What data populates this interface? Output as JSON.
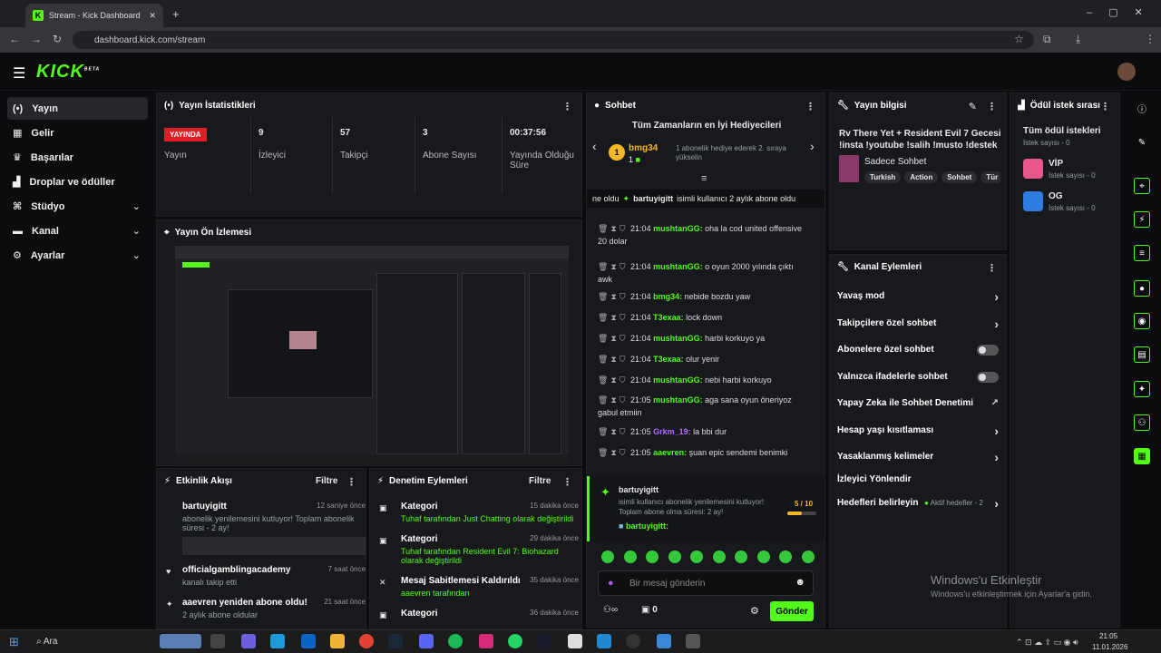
{
  "browser": {
    "tab_title": "Stream - Kick Dashboard",
    "url": "dashboard.kick.com/stream"
  },
  "brand": {
    "logo": "KICK",
    "beta": "BETA",
    "accent": "#53fc18"
  },
  "sidebar": {
    "items": [
      {
        "label": "Yayın",
        "icon": "broadcast-icon"
      },
      {
        "label": "Gelir",
        "icon": "dollar-icon"
      },
      {
        "label": "Başarılar",
        "icon": "trophy-icon"
      },
      {
        "label": "Droplar ve ödüller",
        "icon": "gift-icon"
      },
      {
        "label": "Stüdyo",
        "icon": "studio-icon"
      },
      {
        "label": "Kanal",
        "icon": "channel-icon"
      },
      {
        "label": "Ayarlar",
        "icon": "gear-icon"
      }
    ]
  },
  "stats": {
    "title": "Yayın İstatistikleri",
    "live_badge": "YAYINDA",
    "live_label": "Yayın",
    "items": [
      {
        "value": "9",
        "label": "İzleyici"
      },
      {
        "value": "57",
        "label": "Takipçi"
      },
      {
        "value": "3",
        "label": "Abone Sayısı"
      },
      {
        "value": "00:37:56",
        "label": "Yayında Olduğu Süre"
      }
    ]
  },
  "preview": {
    "title": "Yayın Ön İzlemesi"
  },
  "chat": {
    "title": "Sohbet",
    "top_gifters_title": "Tüm Zamanların en İyi Hediyecileri",
    "top_gifter": {
      "name": "bmg34",
      "count": "1",
      "rank": "1",
      "note": "1 abonelik hediye ederek 2. sıraya yükselin"
    },
    "banner_prefix": "ne oldu",
    "banner_user": "bartuyigitt",
    "banner_text": "isimli kullanıcı 2 aylık abone oldu",
    "messages": [
      {
        "time": "21:04",
        "user": "mushtanGG:",
        "text": "oha la cod united offensive 20 dolar",
        "color": "#53fc18"
      },
      {
        "time": "21:04",
        "user": "mushtanGG:",
        "text": "o oyun 2000 yılında çıktı awk",
        "color": "#53fc18"
      },
      {
        "time": "21:04",
        "user": "bmg34:",
        "text": "nebide bozdu yaw",
        "color": "#53fc18"
      },
      {
        "time": "21:04",
        "user": "T3exaa:",
        "text": "lock down",
        "color": "#53fc18"
      },
      {
        "time": "21:04",
        "user": "mushtanGG:",
        "text": "harbi korkuyo ya",
        "color": "#53fc18"
      },
      {
        "time": "21:04",
        "user": "T3exaa:",
        "text": "olur yenir",
        "color": "#53fc18"
      },
      {
        "time": "21:04",
        "user": "mushtanGG:",
        "text": "nebi harbi korkuyo",
        "color": "#53fc18"
      },
      {
        "time": "21:05",
        "user": "mushtanGG:",
        "text": "aga sana oyun öneriyoz gabul etmiin",
        "color": "#53fc18"
      },
      {
        "time": "21:05",
        "user": "Grkm_19:",
        "text": "la bbi dur",
        "color": "#b06cff"
      },
      {
        "time": "21:05",
        "user": "aaevren:",
        "text": "şuan epic sendemi benimki",
        "color": "#53fc18"
      }
    ],
    "sub_event": {
      "user": "bartuyigitt",
      "line1": "isimli kullanıcı abonelik yenilemesini kutluyor!",
      "line2": "Toplam abone olma süresi: 2 ay!",
      "progress_text": "5 / 10",
      "progress": 0.5,
      "reply_user": "bartuyigitt:"
    },
    "input_placeholder": "Bir mesaj gönderin",
    "send_label": "Gönder",
    "points": "0"
  },
  "stream_info": {
    "title": "Yayın bilgisi",
    "stream_title": "Rv There Yet + Resident Evil 7 Gecesi !insta !youtube !salih !musto !destek",
    "category": "Sadece Sohbet",
    "tags": [
      "Turkish",
      "Action",
      "Sohbet",
      "Tür"
    ]
  },
  "channel_actions": {
    "title": "Kanal Eylemleri",
    "items": [
      {
        "label": "Yavaş mod",
        "type": "chevron"
      },
      {
        "label": "Takipçilere özel sohbet",
        "type": "chevron"
      },
      {
        "label": "Abonelere özel sohbet",
        "type": "toggle"
      },
      {
        "label": "Yalnızca ifadelerle sohbet",
        "type": "toggle"
      },
      {
        "label": "Yapay Zeka ile Sohbet Denetimi",
        "type": "external"
      },
      {
        "label": "Hesap yaşı kısıtlaması",
        "type": "chevron"
      },
      {
        "label": "Yasaklanmış kelimeler",
        "type": "chevron"
      },
      {
        "label": "İzleyici Yönlendir",
        "type": "none"
      },
      {
        "label": "Hedefleri belirleyin",
        "type": "chevron"
      }
    ],
    "goals_badge": "Aktif hedefler - 2"
  },
  "rewards": {
    "title": "Ödül istek sırası",
    "all_title": "Tüm ödül istekleri",
    "all_count": "İstek sayısı - 0",
    "items": [
      {
        "name": "VİP",
        "count": "İstek sayısı - 0",
        "color": "#e8578a"
      },
      {
        "name": "OG",
        "count": "İstek sayısı - 0",
        "color": "#2f7de1"
      }
    ]
  },
  "activity": {
    "title": "Etkinlik Akışı",
    "filter": "Filtre",
    "items": [
      {
        "user": "bartuyigitt",
        "time": "12 saniye önce",
        "text": "abonelik yenilemesini kutluyor! Toplam abonelik süresi - 2 ay!"
      },
      {
        "user": "officialgamblingacademy",
        "time": "7 saat önce",
        "text": "kanalı takip etti"
      },
      {
        "user": "aaevren yeniden abone oldu!",
        "time": "21 saat önce",
        "text": "2 aylık abone oldular"
      }
    ]
  },
  "moderation": {
    "title": "Denetim Eylemleri",
    "filter": "Filtre",
    "items": [
      {
        "title": "Kategori",
        "time": "15 dakika önce",
        "line": "Tuhaf tarafından Just Chatting olarak değiştirildi"
      },
      {
        "title": "Kategori",
        "time": "29 dakika önce",
        "line": "Tuhaf tarafından Resident Evil 7: Biohazard olarak değiştirildi"
      },
      {
        "title": "Mesaj Sabitlemesi Kaldırıldı",
        "time": "35 dakika önce",
        "line": "aaevren tarafından"
      },
      {
        "title": "Kategori",
        "time": "36 dakika önce",
        "line": ""
      }
    ]
  },
  "watermark": {
    "line1": "Windows'u Etkinleştir",
    "line2": "Windows'u etkinleştirmek için Ayarlar'a gidin."
  },
  "taskbar": {
    "search": "Ara",
    "time": "21:05",
    "date": "11.01.2026"
  }
}
